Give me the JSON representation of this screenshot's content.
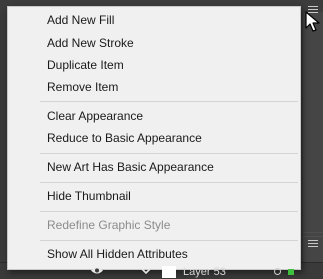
{
  "menu": {
    "items": [
      {
        "label": "Add New Fill",
        "enabled": true
      },
      {
        "label": "Add New Stroke",
        "enabled": true
      },
      {
        "label": "Duplicate Item",
        "enabled": true
      },
      {
        "label": "Remove Item",
        "enabled": true
      },
      {
        "label": "Clear Appearance",
        "enabled": true
      },
      {
        "label": "Reduce to Basic Appearance",
        "enabled": true
      },
      {
        "label": "New Art Has Basic Appearance",
        "enabled": true
      },
      {
        "label": "Hide Thumbnail",
        "enabled": true
      },
      {
        "label": "Redefine Graphic Style",
        "enabled": false
      },
      {
        "label": "Show All Hidden Attributes",
        "enabled": true
      }
    ]
  },
  "layer_row": {
    "name": "Layer 53"
  },
  "colors": {
    "menu_bg": "#f0f0f0",
    "panel_bg": "#3a3a3a",
    "selection_indicator": "#3fbf3f"
  },
  "icons": {
    "panel_menu": "hamburger-icon",
    "visibility": "eye-icon",
    "expand": "chevron-down-icon",
    "target": "target-circle-icon",
    "selection": "selection-square-icon"
  }
}
